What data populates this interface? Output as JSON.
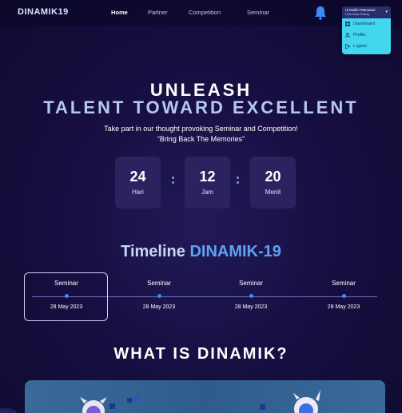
{
  "nav": {
    "logo": "DINAMIK19",
    "links": [
      "Home",
      "Partner",
      "Competition",
      "Seminar"
    ],
    "active": "Home"
  },
  "user_menu": {
    "name": "Hi Dwifitri Ratnawati",
    "subtitle": "Universitas Dalang",
    "items": [
      "Dashboard",
      "Profile",
      "Logout"
    ]
  },
  "hero": {
    "title_line1": "UNLEASH",
    "title_line2": "TALENT TOWARD EXCELLENT",
    "subtitle1": "Take part in our thought provoking Seminar and Competition!",
    "subtitle2": "“Bring Back The Memories”"
  },
  "countdown": [
    {
      "value": "24",
      "label": "Hari"
    },
    {
      "value": "12",
      "label": "Jam"
    },
    {
      "value": "20",
      "label": "Menit"
    }
  ],
  "timeline": {
    "title_part1": "Timeline",
    "title_part2": "DINAMIK-19",
    "events": [
      {
        "label": "Seminar",
        "date": "28 May 2023"
      },
      {
        "label": "Seminar",
        "date": "28 May 2023"
      },
      {
        "label": "Seminar",
        "date": "28 May 2023"
      },
      {
        "label": "Seminar",
        "date": "28 May 2023"
      }
    ]
  },
  "about": {
    "title": "WHAT IS DINAMIK?"
  },
  "colors": {
    "background": "#170f42",
    "accent_blue": "#5ea3f0",
    "menu_cyan": "#42d6ef",
    "bell_blue": "#3d8af7"
  },
  "icons": [
    "bell-icon",
    "chevron-down-icon",
    "dashboard-icon",
    "profile-icon",
    "logout-icon"
  ]
}
